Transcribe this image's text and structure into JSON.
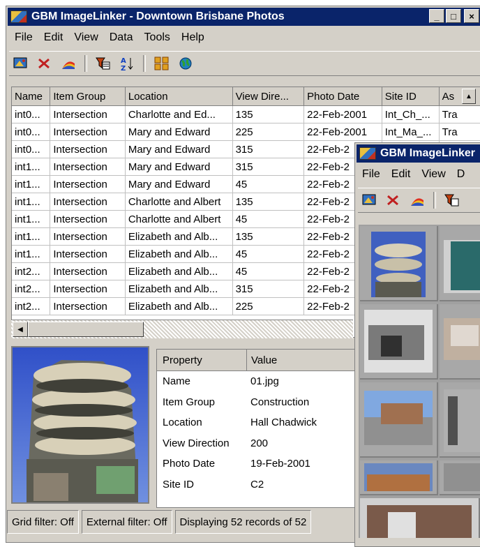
{
  "main_window": {
    "title": "GBM ImageLinker - Downtown Brisbane Photos",
    "menu": [
      "File",
      "Edit",
      "View",
      "Data",
      "Tools",
      "Help"
    ],
    "title_buttons": [
      "_",
      "□",
      "×"
    ]
  },
  "toolbar_icons": [
    "link-photo-icon",
    "unlink-icon",
    "chart-icon",
    "filter-icon",
    "sort-az-icon",
    "thumbnails-icon",
    "web-globe-icon"
  ],
  "grid": {
    "columns": [
      "Name",
      "Item Group",
      "Location",
      "View Dire...",
      "Photo Date",
      "Site ID",
      "As"
    ],
    "rows": [
      [
        "int0...",
        "Intersection",
        "Charlotte and Ed...",
        "135",
        "22-Feb-2001",
        "Int_Ch_...",
        "Tra"
      ],
      [
        "int0...",
        "Intersection",
        "Mary and Edward",
        "225",
        "22-Feb-2001",
        "Int_Ma_...",
        "Tra"
      ],
      [
        "int0...",
        "Intersection",
        "Mary and Edward",
        "315",
        "22-Feb-2",
        "",
        ""
      ],
      [
        "int1...",
        "Intersection",
        "Mary and Edward",
        "315",
        "22-Feb-2",
        "",
        ""
      ],
      [
        "int1...",
        "Intersection",
        "Mary and Edward",
        "45",
        "22-Feb-2",
        "",
        ""
      ],
      [
        "int1...",
        "Intersection",
        "Charlotte and Albert",
        "135",
        "22-Feb-2",
        "",
        ""
      ],
      [
        "int1...",
        "Intersection",
        "Charlotte and Albert",
        "45",
        "22-Feb-2",
        "",
        ""
      ],
      [
        "int1...",
        "Intersection",
        "Elizabeth and Alb...",
        "135",
        "22-Feb-2",
        "",
        ""
      ],
      [
        "int1...",
        "Intersection",
        "Elizabeth and Alb...",
        "45",
        "22-Feb-2",
        "",
        ""
      ],
      [
        "int2...",
        "Intersection",
        "Elizabeth and Alb...",
        "45",
        "22-Feb-2",
        "",
        ""
      ],
      [
        "int2...",
        "Intersection",
        "Elizabeth and Alb...",
        "315",
        "22-Feb-2",
        "",
        ""
      ],
      [
        "int2...",
        "Intersection",
        "Elizabeth and Alb...",
        "225",
        "22-Feb-2",
        "",
        ""
      ]
    ]
  },
  "properties": {
    "header": [
      "Property",
      "Value"
    ],
    "rows": [
      [
        "Name",
        "01.jpg"
      ],
      [
        "Item Group",
        "Construction"
      ],
      [
        "Location",
        "Hall Chadwick"
      ],
      [
        "View Direction",
        "200"
      ],
      [
        "Photo Date",
        "19-Feb-2001"
      ],
      [
        "Site ID",
        "C2"
      ]
    ]
  },
  "status": {
    "grid_filter": "Grid filter: Off",
    "external_filter": "External filter: Off",
    "record_count": "Displaying 52 records of 52"
  },
  "second_window": {
    "title": "GBM ImageLinker",
    "menu": [
      "File",
      "Edit",
      "View",
      "D"
    ]
  }
}
